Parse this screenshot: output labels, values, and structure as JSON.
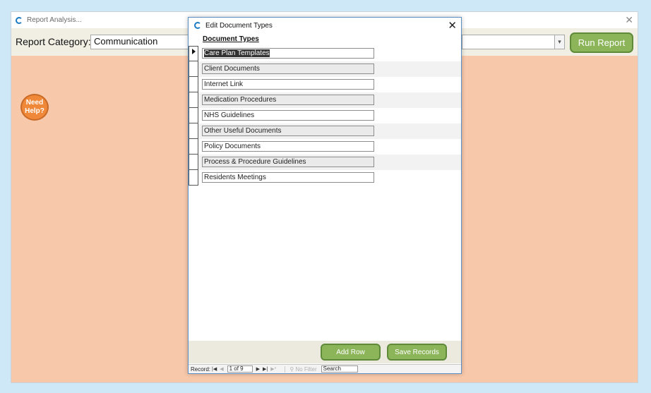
{
  "main_window": {
    "title": "Report Analysis...",
    "report_category_label": "Report Category:",
    "report_category_value": "Communication",
    "run_report_label": "Run Report",
    "help_line1": "Need",
    "help_line2": "Help?"
  },
  "dialog": {
    "title": "Edit Document Types",
    "column_header": "Document Types",
    "rows": [
      "Care Plan Templates",
      "Client Documents",
      "Internet Link",
      "Medication Procedures",
      "NHS Guidelines",
      "Other Useful Documents",
      "Policy Documents",
      "Process & Procedure Guidelines",
      "Residents Meetings"
    ],
    "add_row_label": "Add Row",
    "save_records_label": "Save Records"
  },
  "navigation": {
    "record_label": "Record:",
    "record_value": "1 of 9",
    "filter_label": "No Filter",
    "search_value": "Search"
  },
  "colors": {
    "background": "#f8c8aa",
    "accent_green": "#8cb55a",
    "help_orange": "#f0883a"
  }
}
